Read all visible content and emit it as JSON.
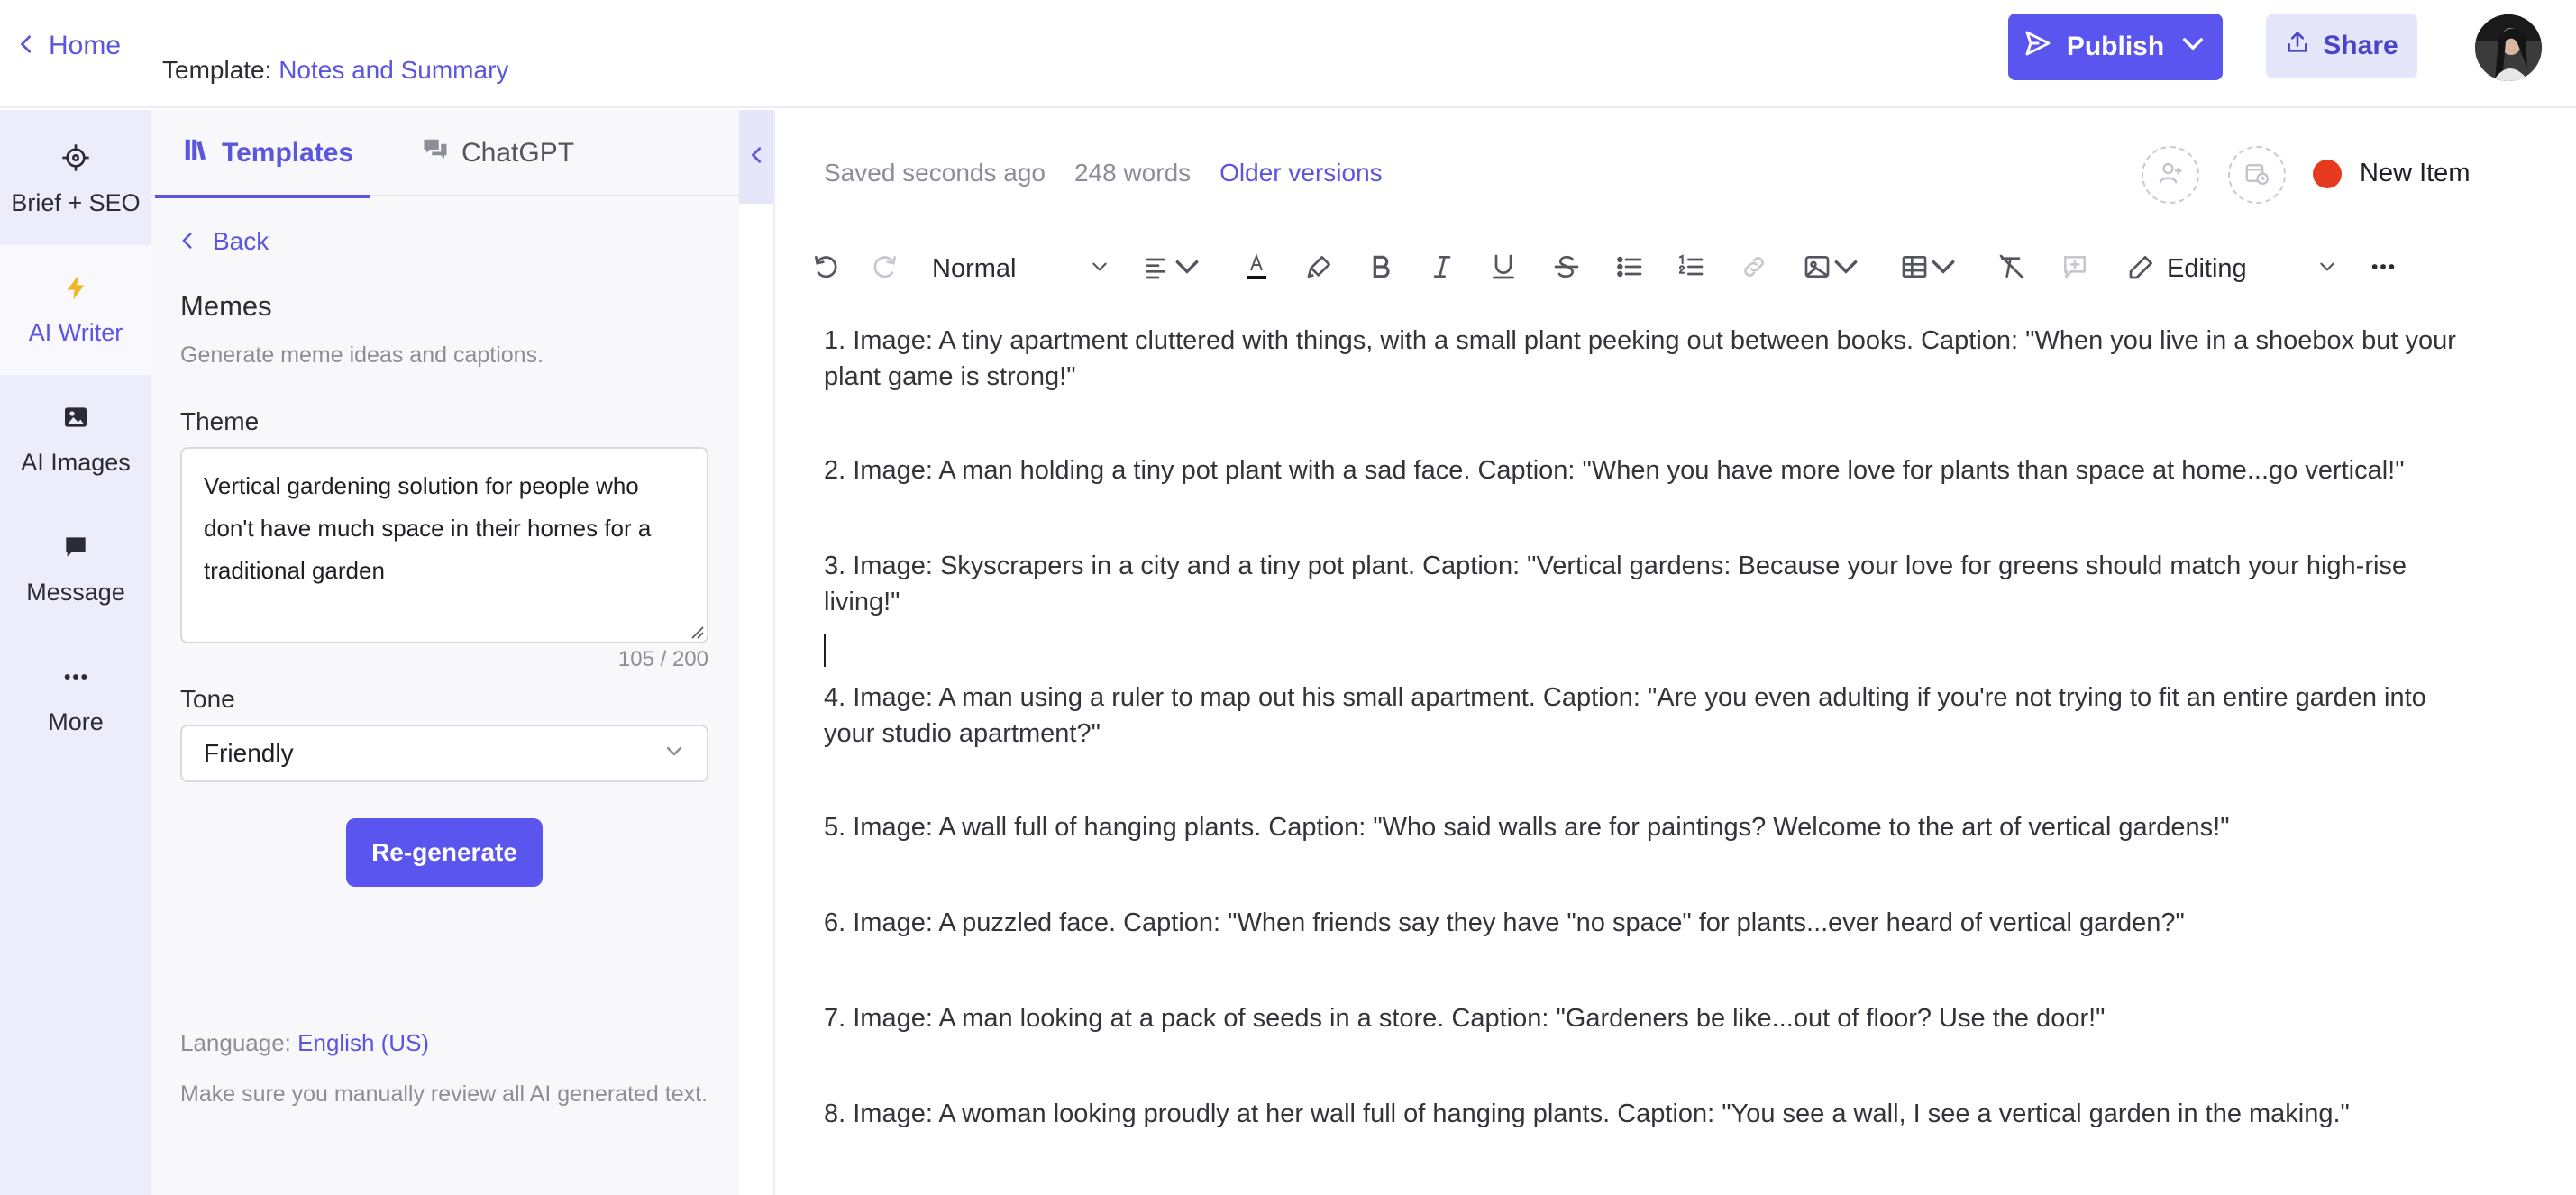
{
  "header": {
    "home_label": "Home",
    "template_prefix": "Template:",
    "template_name": "Notes and Summary",
    "publish_label": "Publish",
    "share_label": "Share"
  },
  "rail": {
    "items": [
      {
        "label": "Brief + SEO",
        "icon": "crosshair-icon"
      },
      {
        "label": "AI Writer",
        "icon": "lightning-icon"
      },
      {
        "label": "AI Images",
        "icon": "image-icon"
      },
      {
        "label": "Message",
        "icon": "chat-bubble-icon"
      },
      {
        "label": "More",
        "icon": "ellipsis-icon"
      }
    ]
  },
  "panel": {
    "tabs": [
      {
        "label": "Templates",
        "icon": "library-icon"
      },
      {
        "label": "ChatGPT",
        "icon": "chat-bubbles-icon"
      }
    ],
    "back_label": "Back",
    "title": "Memes",
    "description": "Generate meme ideas and captions.",
    "theme_label": "Theme",
    "theme_value": "Vertical gardening solution for people who don't have much space in their homes for a traditional garden",
    "char_count": "105 / 200",
    "tone_label": "Tone",
    "tone_value": "Friendly",
    "regenerate_label": "Re-generate",
    "language_prefix": "Language:",
    "language_value": "English (US)",
    "review_note": "Make sure you manually review all AI generated text."
  },
  "editor": {
    "saved_status": "Saved seconds ago",
    "word_count": "248 words",
    "older_versions": "Older versions",
    "new_item_label": "New Item",
    "toolbar": {
      "paragraph_style": "Normal",
      "mode": "Editing"
    },
    "paragraphs": [
      "1. Image: A tiny apartment cluttered with things, with a small plant peeking out between books. Caption: \"When you live in a shoebox but your plant game is strong!\"",
      "2. Image: A man holding a tiny pot plant with a sad face. Caption: \"When you have more love for plants than space at home...go vertical!\"",
      "3. Image: Skyscrapers in a city and a tiny pot plant. Caption: \"Vertical gardens: Because your love for greens should match your high-rise living!\"",
      "4. Image: A man using a ruler to map out his small apartment. Caption: \"Are you even adulting if you're not trying to fit an entire garden into your studio apartment?\"",
      "5. Image: A wall full of hanging plants. Caption: \"Who said walls are for paintings? Welcome to the art of vertical gardens!\"",
      "6. Image: A puzzled face. Caption: \"When friends say they have \"no space\" for plants...ever heard of vertical garden?\"",
      "7. Image: A man looking at a pack of seeds in a store. Caption: \"Gardeners be like...out of floor? Use the door!\"",
      "8. Image: A woman looking proudly at her wall full of hanging plants. Caption: \"You see a wall, I see a vertical garden in the making.\""
    ]
  },
  "colors": {
    "accent": "#5b55f0",
    "accent_text": "#5b55e0",
    "status_dot": "#e63a1e",
    "rail_bg": "#ececfa"
  }
}
